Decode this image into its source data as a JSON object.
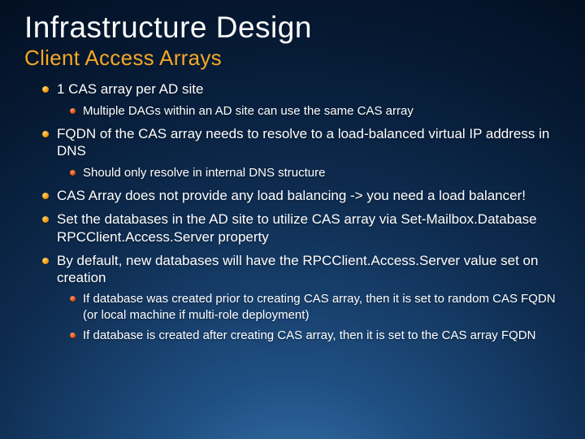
{
  "title": "Infrastructure Design",
  "subtitle": "Client Access Arrays",
  "bullets": {
    "b1": "1 CAS array per AD site",
    "b1_1": "Multiple DAGs within an AD site can use the same CAS array",
    "b2": "FQDN of the CAS array needs to resolve to a load-balanced virtual IP address in DNS",
    "b2_1": "Should only resolve in internal DNS structure",
    "b3": "CAS Array does not provide any load balancing -> you need a load balancer!",
    "b4": "Set the databases in the AD site to utilize CAS array via Set-Mailbox.Database RPCClient.Access.Server property",
    "b5": "By default, new databases will have the RPCClient.Access.Server value set on creation",
    "b5_1": "If database was created prior to creating CAS array, then it is set to random CAS FQDN (or local machine if multi-role deployment)",
    "b5_2": "If database is created after creating CAS array, then it is set to the CAS array FQDN"
  }
}
